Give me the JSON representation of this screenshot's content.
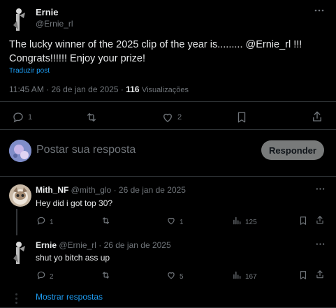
{
  "post": {
    "author_name": "Ernie",
    "author_handle": "@Ernie_rl",
    "text_line1": "The lucky winner of the 2025 clip of the year is......... @Ernie_rl !!!",
    "text_line2": "Congrats!!!!!! Enjoy your prize!",
    "translate_label": "Traduzir post",
    "time": "11:45 AM · 26 de jan de 2025 ·",
    "views_count": "116",
    "views_label": "Visualizações",
    "reply_count": "1",
    "like_count": "2"
  },
  "composer": {
    "placeholder": "Postar sua resposta",
    "button_label": "Responder"
  },
  "replies": [
    {
      "author_name": "Mith_NF",
      "author_handle": "@mith_glo",
      "date": "· 26 de jan de 2025",
      "text": "Hey did i got top 30?",
      "reply_count": "1",
      "like_count": "1",
      "views_count": "125"
    },
    {
      "author_name": "Ernie",
      "author_handle": "@Ernie_rl",
      "date": "· 26 de jan de 2025",
      "text": "shut yo bitch ass up",
      "reply_count": "2",
      "like_count": "5",
      "views_count": "167"
    }
  ],
  "show_more": "Mostrar respostas",
  "colors": {
    "background": "#000000",
    "text": "#e7e9ea",
    "muted": "#71767b",
    "accent": "#1d9bf0",
    "divider": "#2f3336"
  },
  "icons": [
    "more-icon",
    "reply-icon",
    "repost-icon",
    "like-icon",
    "bookmark-icon",
    "share-icon",
    "views-icon"
  ]
}
